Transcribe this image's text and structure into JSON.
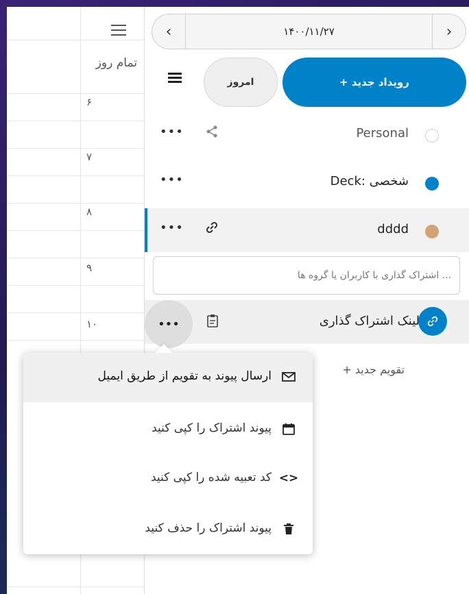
{
  "colors": {
    "accent": "#0082c9",
    "deck_bullet": "#0082c9",
    "dddd_bullet": "#d4a373",
    "personal_bullet": "#ffffff"
  },
  "grid": {
    "allday_label": "تمام روز",
    "day_numbers": [
      "۶",
      "۷",
      "۸",
      "۹",
      "۱۰"
    ]
  },
  "date_nav": {
    "date": "۱۴۰۰/۱۱/۲۷",
    "prev_icon": "chevron-left-icon",
    "next_icon": "chevron-right-icon"
  },
  "toolbar": {
    "new_event_label": "+ رویداد جدید",
    "today_label": "امروز"
  },
  "calendars": [
    {
      "name": "Personal",
      "action_icon": "share-icon"
    },
    {
      "name": "Deck: شخصی",
      "action_icon": ""
    },
    {
      "name": "dddd",
      "action_icon": "link-icon"
    }
  ],
  "share": {
    "placeholder": "اشتراک گذاری با کاربران یا گروه ها ...",
    "link_label": "لینک اشتراک گذاری"
  },
  "new_calendar_label": "+ تقویم جدید",
  "menu": {
    "items": [
      {
        "label": "ارسال پیوند به تقویم از طریق ایمیل",
        "icon": "email-icon"
      },
      {
        "label": "پیوند اشتراک را کپی کنید",
        "icon": "calendar-icon"
      },
      {
        "label": "کد تعبیه شده را کپی کنید",
        "icon": "code-icon"
      },
      {
        "label": "پیوند اشتراک را حذف کنید",
        "icon": "trash-icon"
      }
    ]
  }
}
